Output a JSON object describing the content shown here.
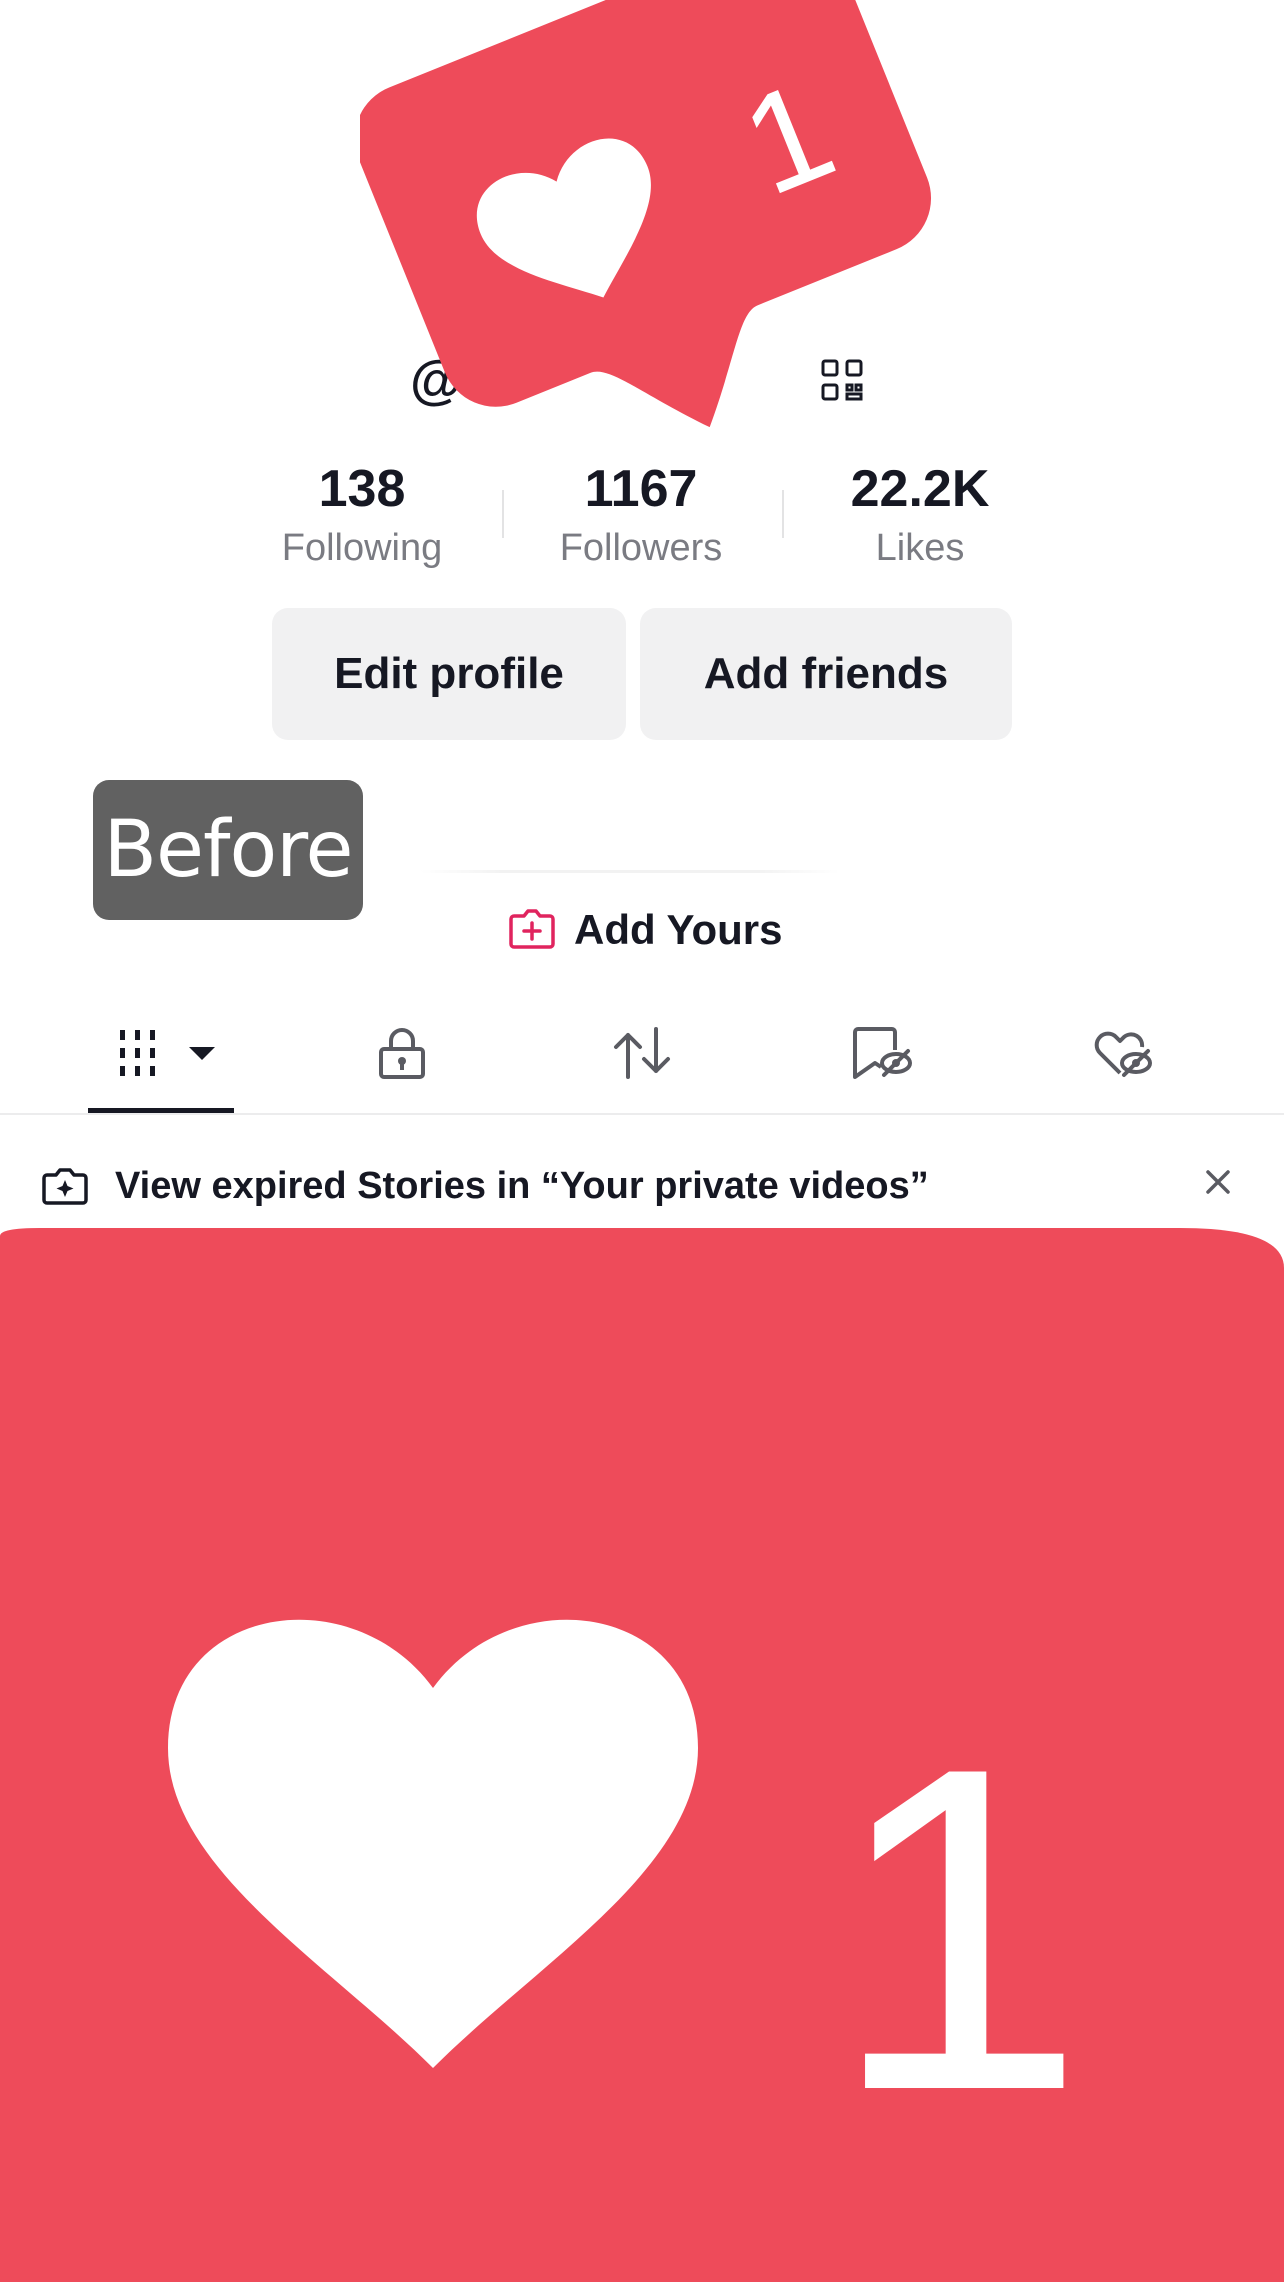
{
  "profile": {
    "username_prefix": "@"
  },
  "stats": [
    {
      "value": "138",
      "label": "Following"
    },
    {
      "value": "1167",
      "label": "Followers"
    },
    {
      "value": "22.2K",
      "label": "Likes"
    }
  ],
  "buttons": {
    "edit_profile": "Edit profile",
    "add_friends": "Add friends"
  },
  "badge": {
    "label": "Before"
  },
  "add_yours": {
    "label": "Add Yours"
  },
  "tabs": [
    {
      "icon": "grid-icon",
      "active": true
    },
    {
      "icon": "lock-icon",
      "active": false
    },
    {
      "icon": "repost-icon",
      "active": false
    },
    {
      "icon": "favorites-hidden-icon",
      "active": false
    },
    {
      "icon": "liked-hidden-icon",
      "active": false
    }
  ],
  "banner": {
    "text": "View expired Stories in “Your private videos”"
  },
  "notification": {
    "count_small": "1",
    "count_large": "1"
  },
  "colors": {
    "notification_red": "#EE4B5A",
    "brand_pink": "#E0245E",
    "text_primary": "#161823",
    "text_secondary": "#7A7B82",
    "button_bg": "#F1F1F2",
    "badge_bg": "#616161"
  }
}
